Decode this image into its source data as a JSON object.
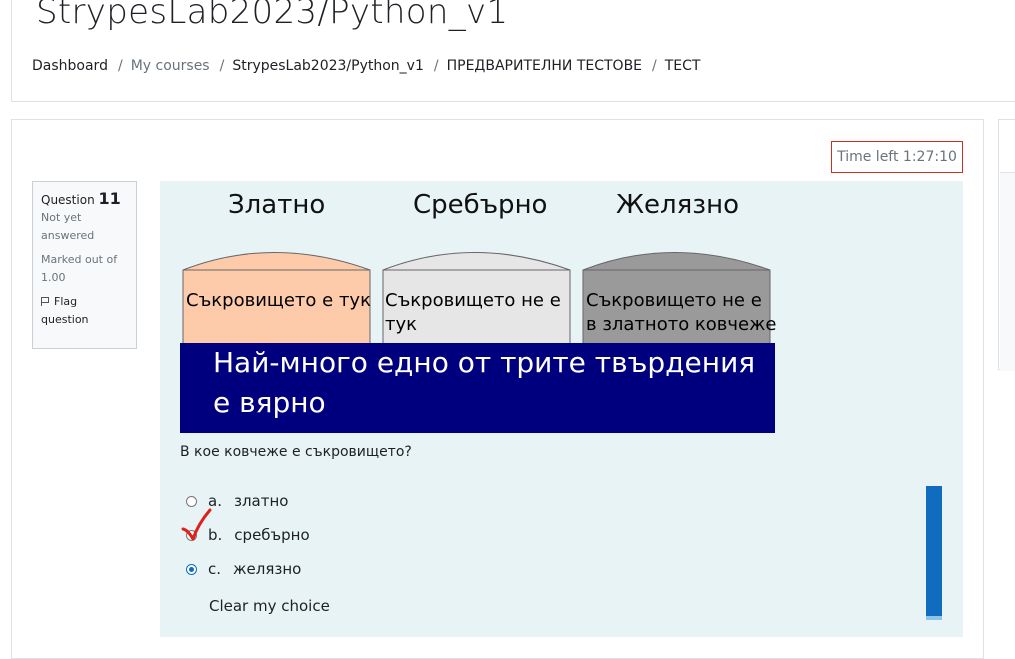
{
  "header": {
    "title": "StrypesLab2023/Python_v1",
    "breadcrumb": [
      {
        "label": "Dashboard",
        "muted": false
      },
      {
        "label": "My courses",
        "muted": true
      },
      {
        "label": "StrypesLab2023/Python_v1",
        "muted": false
      },
      {
        "label": "ПРЕДВАРИТЕЛНИ ТЕСТОВЕ",
        "muted": false
      },
      {
        "label": "ТЕСТ",
        "muted": false
      }
    ],
    "separator": "/"
  },
  "timer": {
    "label": "Time left 1:27:10"
  },
  "question_info": {
    "question_label": "Question",
    "question_number": "11",
    "status": "Not yet answered",
    "marked_out_of": "Marked out of 1.00",
    "flag_label": "Flag question"
  },
  "puzzle": {
    "chests": [
      {
        "title": "Златно",
        "statement": [
          "Съкровището е тук"
        ],
        "fill": "#fdcba9"
      },
      {
        "title": "Сребърно",
        "statement": [
          "Съкровището не е",
          "тук"
        ],
        "fill": "#e6e6e6"
      },
      {
        "title": "Желязно",
        "statement": [
          "Съкровището не е",
          "в златното ковчеже"
        ],
        "fill": "#9a9a9a"
      }
    ],
    "banner_lines": [
      "Най-много едно от трите твърдения",
      "е вярно"
    ],
    "banner_color": "#00007f"
  },
  "prompt": "В кое ковчеже е съкровището?",
  "answers": [
    {
      "letter": "a.",
      "text": "златно",
      "checked": false
    },
    {
      "letter": "b.",
      "text": "сребърно",
      "checked": false
    },
    {
      "letter": "c.",
      "text": "желязно",
      "checked": true
    }
  ],
  "clear_choice": "Clear my choice",
  "colors": {
    "accent": "#0f6cbf",
    "timer_border": "#ca3120",
    "content_bg": "#e7f3f5",
    "tick": "#e0201b"
  }
}
